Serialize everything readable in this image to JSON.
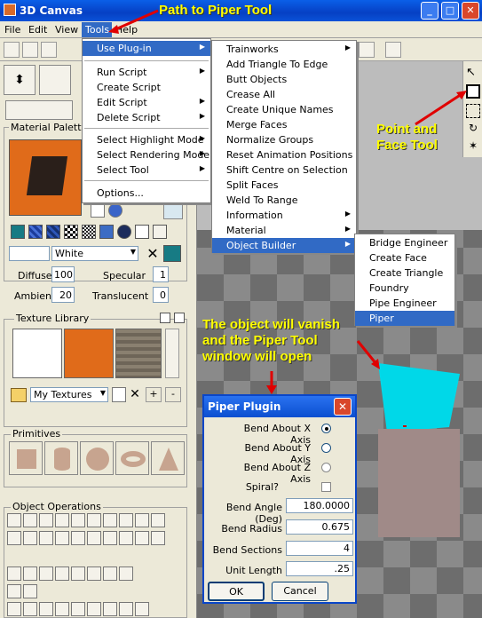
{
  "window": {
    "title": "3D Canvas"
  },
  "menubar": {
    "items": [
      "File",
      "Edit",
      "View",
      "Tools",
      "Help"
    ]
  },
  "tools_menu": {
    "items": [
      {
        "label": "Use Plug-in",
        "arrow": true
      },
      {
        "label": "Run Script",
        "arrow": true
      },
      {
        "label": "Create Script",
        "arrow": false
      },
      {
        "label": "Edit Script",
        "arrow": true
      },
      {
        "label": "Delete Script",
        "arrow": true
      },
      {
        "label": "Select Highlight Mode",
        "arrow": true
      },
      {
        "label": "Select Rendering Mode",
        "arrow": true
      },
      {
        "label": "Select Tool",
        "arrow": true
      },
      {
        "label": "Options...",
        "arrow": false
      }
    ]
  },
  "plugin_menu": {
    "items": [
      "Trainworks",
      "Add Triangle To Edge",
      "Butt Objects",
      "Crease All",
      "Create Unique Names",
      "Merge Faces",
      "Normalize Groups",
      "Reset Animation Positions",
      "Shift Centre on Selection",
      "Split Faces",
      "Weld To Range",
      "Information",
      "Material",
      "Object Builder"
    ]
  },
  "builder_menu": {
    "items": [
      "Bridge Engineer",
      "Create Face",
      "Create Triangle",
      "Foundry",
      "Pipe Engineer",
      "Piper"
    ]
  },
  "annotations": {
    "path": "Path to Piper Tool",
    "point": "Point and Face Tool",
    "vanish": "The object will vanish and the Piper Tool window will open"
  },
  "material_palette": {
    "title": "Material Palette",
    "color_name": "White",
    "diffuse_label": "Diffuse",
    "diffuse": "100",
    "specular_label": "Specular",
    "specular": "1",
    "ambient_label": "Ambient",
    "ambient": "20",
    "translucent_label": "Translucent",
    "translucent": "0"
  },
  "texture_library": {
    "title": "Texture Library",
    "selection": "My Textures"
  },
  "primitives": {
    "title": "Primitives"
  },
  "object_operations": {
    "title": "Object Operations"
  },
  "dialog": {
    "title": "Piper Plugin",
    "bend_x": "Bend About X Axis",
    "bend_y": "Bend About Y Axis",
    "bend_z": "Bend About Z Axis",
    "spiral": "Spiral?",
    "angle_label": "Bend Angle (Deg)",
    "angle": "180.0000",
    "radius_label": "Bend Radius",
    "radius": "0.675",
    "sections_label": "Bend Sections",
    "sections": "4",
    "unit_label": "Unit Length",
    "unit": ".25",
    "ok": "OK",
    "cancel": "Cancel"
  },
  "colors": {
    "accent": "#316ac5",
    "annotation": "#ffff00",
    "arrow": "#e00000"
  }
}
